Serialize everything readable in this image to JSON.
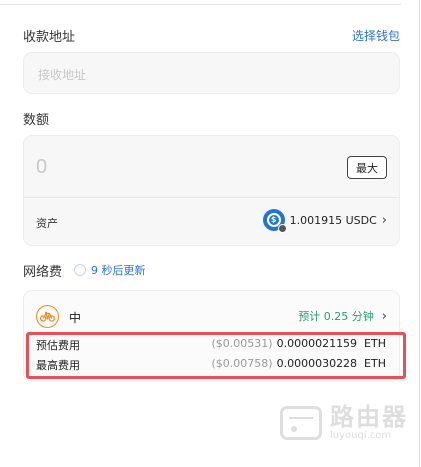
{
  "recipient": {
    "label": "收款地址",
    "choose_wallet": "选择钱包",
    "placeholder": "接收地址"
  },
  "amount": {
    "label": "数额",
    "value": "0",
    "max_label": "最大",
    "asset_label": "资产",
    "asset_value": "1.001915 USDC",
    "asset_icon": "usdc-icon",
    "chevron": "›"
  },
  "network_fee": {
    "label": "网络费",
    "refresh_text": "9 秒后更新",
    "speed_label": "中",
    "speed_icon": "bicycle-icon",
    "eta_text": "预计 0.25 分钟",
    "chevron": "›"
  },
  "fees": [
    {
      "label": "预估费用",
      "usd": "($0.00531)",
      "eth": "0.0000021159  ETH"
    },
    {
      "label": "最高费用",
      "usd": "($0.00758)",
      "eth": "0.0000030228  ETH"
    }
  ],
  "watermark": {
    "cn": "路由器",
    "en": "luyouqi.com"
  },
  "colors": {
    "link": "#2f6fdf",
    "eta": "#22a06b",
    "highlight": "#e94f55",
    "speed_icon": "#f08a24"
  }
}
